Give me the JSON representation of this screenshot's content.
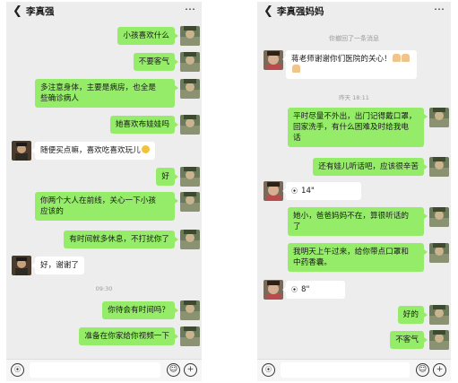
{
  "left_chat": {
    "title": "李真强",
    "messages": [
      {
        "text": "小孩喜欢什么"
      },
      {
        "text": "不要客气"
      },
      {
        "text": "多注意身体，主要是病房，也全是\n些确诊病人"
      },
      {
        "text": "她喜欢布娃娃吗"
      },
      {
        "text": "随便买点嘛，喜欢吃喜欢玩儿"
      },
      {
        "text": "好"
      },
      {
        "text": "你两个大人在前线，关心一下小孩\n应该的"
      },
      {
        "text": "有时间就多休息，不打扰你了"
      },
      {
        "text": "好，谢谢了"
      },
      {
        "text": "你待会有时间吗？"
      },
      {
        "text": "准备在你家给你视频一下"
      }
    ],
    "timestamp": "09:30"
  },
  "right_chat": {
    "title": "李真强妈妈",
    "recalled_notice": "你撤回了一条消息",
    "timestamp": "昨天 18:11",
    "messages": [
      {
        "text": "蒋老师谢谢你们医院的关心！"
      },
      {
        "text": "平时尽量不外出，出门记得戴口罩，\n回家洗手，有什么困难及时给我电\n话"
      },
      {
        "text": "还有娃儿听话吧，应该很辛苦"
      },
      {
        "text": "14\""
      },
      {
        "text": "她小，爸爸妈妈不在，算很听话的\n了"
      },
      {
        "text": "我明天上午过来，给你带点口罩和\n中药香囊。"
      },
      {
        "text": "8\""
      },
      {
        "text": "好的"
      },
      {
        "text": "不客气"
      }
    ]
  },
  "icons": {
    "back": "chevron-left-icon",
    "more": "more-dots-icon",
    "voice": "voice-icon",
    "emoji": "emoji-icon",
    "plus": "plus-icon"
  },
  "colors": {
    "chat_bg": "#ededed",
    "sent_bubble": "#95ec69",
    "received_bubble": "#ffffff"
  }
}
